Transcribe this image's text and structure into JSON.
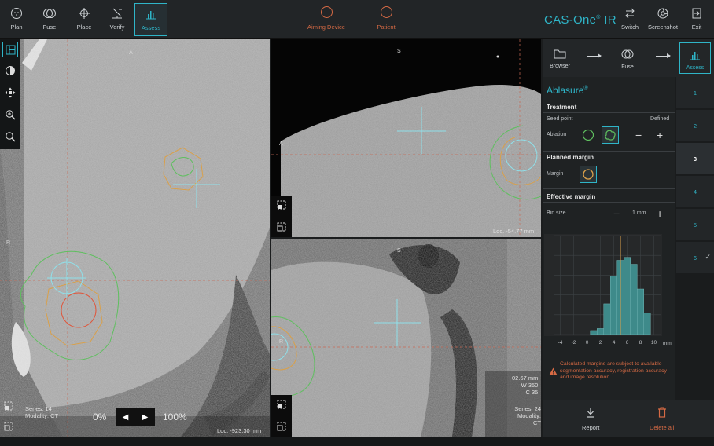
{
  "toolbar": {
    "left": [
      {
        "id": "plan",
        "label": "Plan",
        "icon": "plan-icon"
      },
      {
        "id": "fuse",
        "label": "Fuse",
        "icon": "fuse-icon"
      },
      {
        "id": "place",
        "label": "Place",
        "icon": "crosshair-icon"
      },
      {
        "id": "verify",
        "label": "Verify",
        "icon": "verify-icon"
      },
      {
        "id": "assess",
        "label": "Assess",
        "icon": "histogram-icon",
        "active": true
      }
    ],
    "center": [
      {
        "id": "aiming-device",
        "label": "Aiming Device"
      },
      {
        "id": "patient",
        "label": "Patient"
      }
    ],
    "brand": "CAS-One",
    "brand_reg": "®",
    "brand_suffix": " IR",
    "right": [
      {
        "id": "switch",
        "label": "Switch",
        "icon": "switch-icon"
      },
      {
        "id": "screenshot",
        "label": "Screenshot",
        "icon": "screenshot-icon"
      },
      {
        "id": "exit",
        "label": "Exit",
        "icon": "exit-icon"
      }
    ]
  },
  "viewports": {
    "left": {
      "orient_top": "A",
      "orient_left": "R",
      "series": "Series: 14",
      "modality": "Modality: CT",
      "loc": "Loc. -923.30 mm",
      "slider_min": "0%",
      "slider_max": "100%"
    },
    "top_right": {
      "orient_top": "S",
      "orient_left": "A",
      "loc": "Loc. -54.77 mm"
    },
    "bottom_right": {
      "orient_top": "S",
      "orient_left": "R",
      "loc": "02.67 mm",
      "window": "W 350",
      "center": "C 35",
      "series": "Series: 24",
      "modality": "Modality: CT"
    }
  },
  "nav": {
    "items": [
      {
        "label": "Browser",
        "icon": "folder-icon"
      },
      {
        "label": "Fuse",
        "icon": "fuse-icon"
      },
      {
        "label": "Assess",
        "icon": "histogram-icon",
        "active": true
      }
    ]
  },
  "panel": {
    "title": "Ablasure",
    "title_reg": "®",
    "treatment": {
      "heading": "Treatment",
      "seed_point": "Seed point",
      "defined": "Defined",
      "ablation_label": "Ablation",
      "minus": "−",
      "plus": "+"
    },
    "planned_margin": {
      "heading": "Planned margin",
      "margin_label": "Margin"
    },
    "effective_margin": {
      "heading": "Effective margin",
      "bin_size_label": "Bin size",
      "bin_size_value": "1 mm",
      "minus": "−",
      "plus": "+"
    },
    "warning": "Calculated margins are subject to available segmentation accuracy, registration accuracy and image resolution."
  },
  "steps": [
    {
      "label": "1"
    },
    {
      "label": "2"
    },
    {
      "label": "3",
      "active": true
    },
    {
      "label": "4"
    },
    {
      "label": "5"
    },
    {
      "label": "6",
      "checked": true
    }
  ],
  "actions": {
    "report": "Report",
    "delete_all": "Delete all"
  },
  "colors": {
    "accent": "#2fb5c8",
    "warning": "#d66a44",
    "contour_green": "#5fbf5f",
    "contour_orange": "#d9a04a",
    "contour_red": "#e0553a"
  },
  "chart_data": {
    "type": "bar",
    "y_unit_label": "%",
    "x_unit_label": "mm",
    "xlim": [
      -5,
      11
    ],
    "x_ticks": [
      "-4",
      "-2",
      "0",
      "2",
      "4",
      "6",
      "8",
      "10"
    ],
    "red_line_x": 0,
    "orange_line_x": 5,
    "bins": [
      1,
      2,
      3,
      4,
      5,
      6,
      7,
      8,
      9
    ],
    "values": [
      0.8,
      1.2,
      6.2,
      11.8,
      15.0,
      15.6,
      14.2,
      9.2,
      4.4
    ],
    "ylim": [
      0,
      20
    ],
    "grid": true
  }
}
